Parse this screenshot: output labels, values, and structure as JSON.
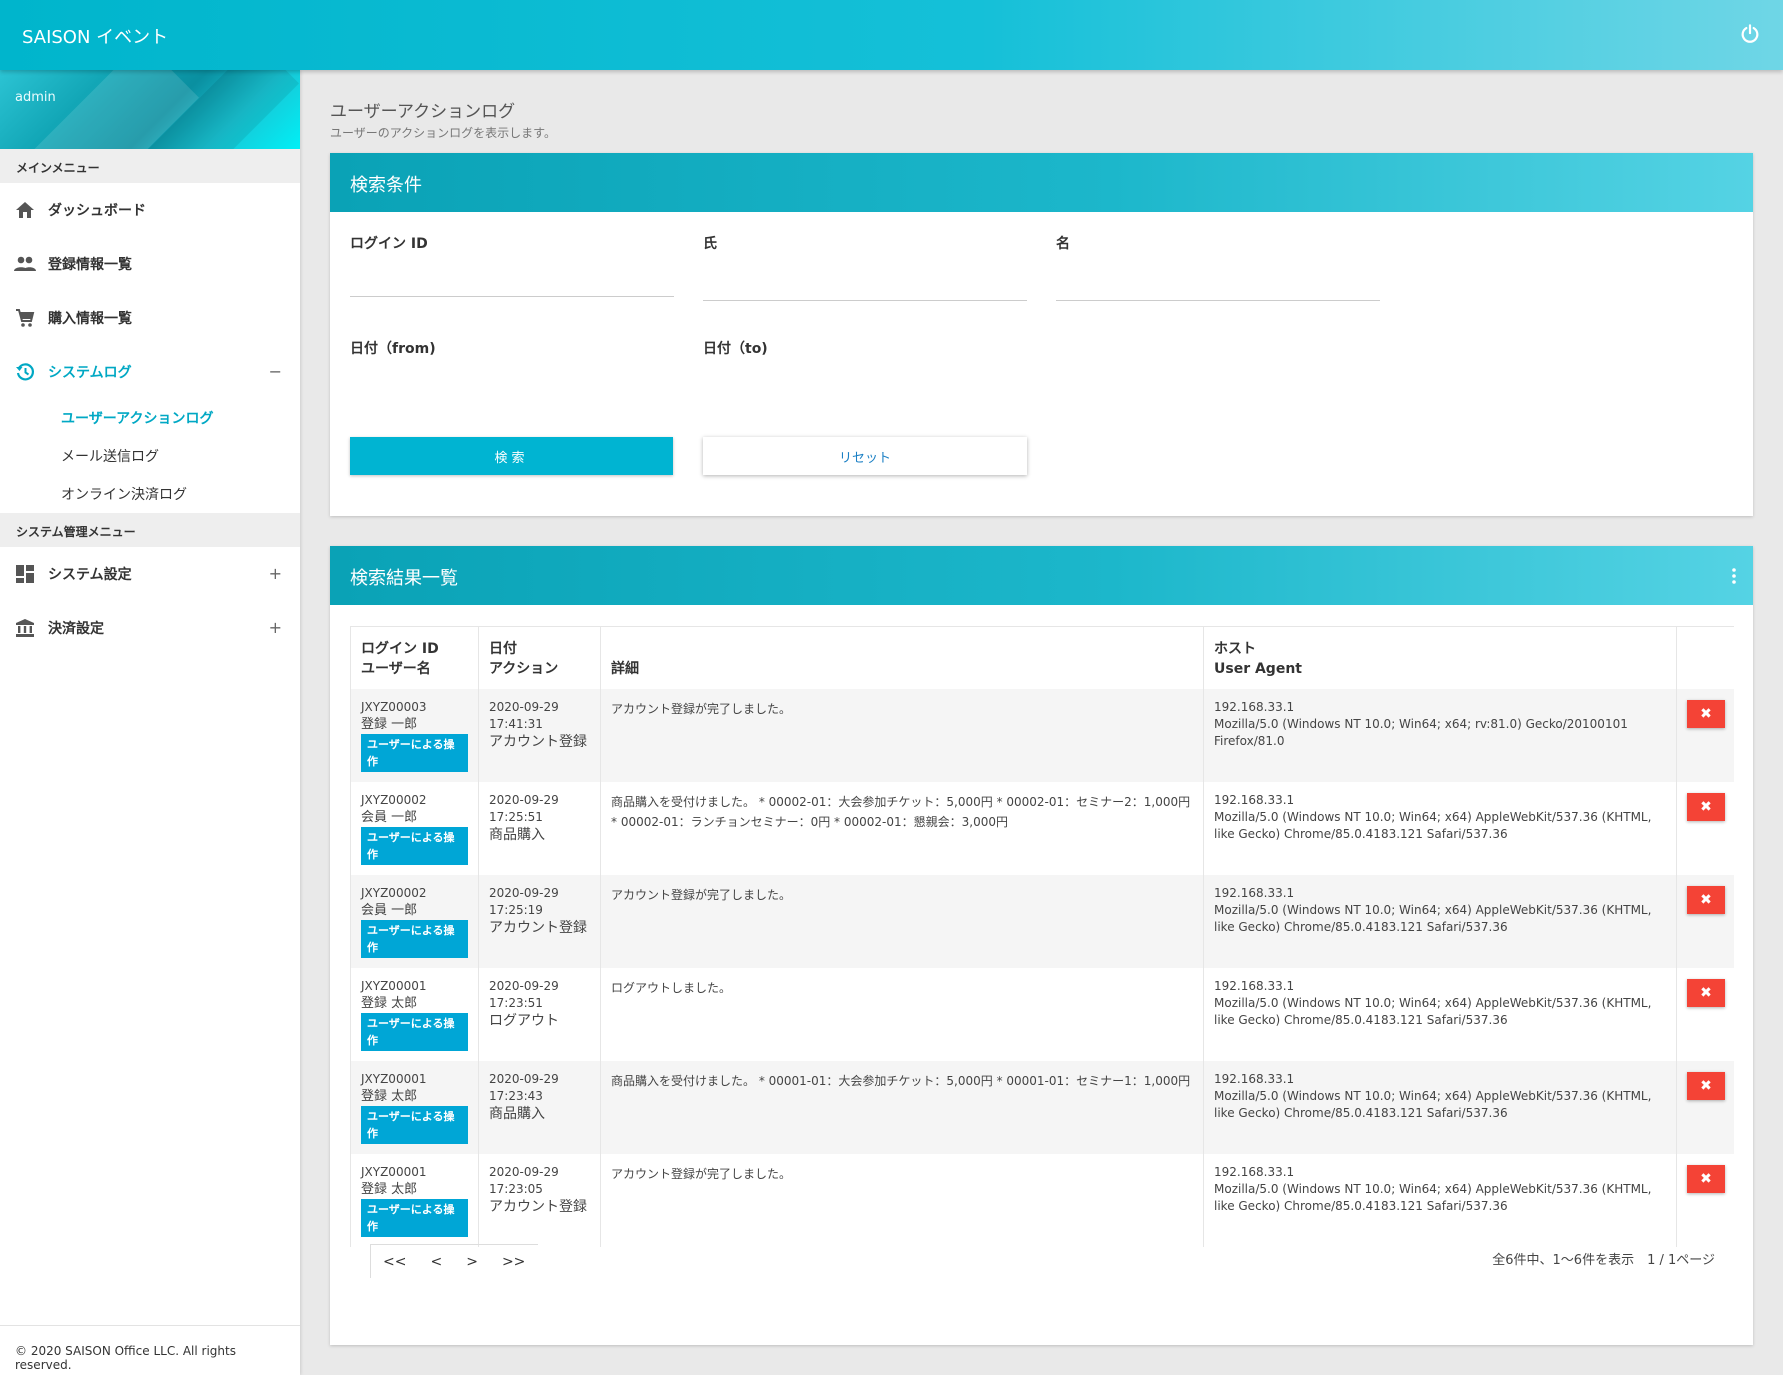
{
  "app": {
    "title": "SAISON イベント"
  },
  "sidebar": {
    "user": "admin",
    "main_menu_header": "メインメニュー",
    "items": [
      {
        "label": "ダッシュボード",
        "icon": "home-icon"
      },
      {
        "label": "登録情報一覧",
        "icon": "people-icon"
      },
      {
        "label": "購入情報一覧",
        "icon": "cart-icon"
      },
      {
        "label": "システムログ",
        "icon": "history-icon",
        "toggle": "−"
      }
    ],
    "subitems": [
      {
        "label": "ユーザーアクションログ"
      },
      {
        "label": "メール送信ログ"
      },
      {
        "label": "オンライン決済ログ"
      }
    ],
    "admin_menu_header": "システム管理メニュー",
    "admin_items": [
      {
        "label": "システム設定",
        "icon": "dashboard-icon",
        "toggle": "+"
      },
      {
        "label": "決済設定",
        "icon": "bank-icon",
        "toggle": "+"
      }
    ],
    "footer": "© 2020 SAISON Office LLC. All rights reserved."
  },
  "page": {
    "title": "ユーザーアクションログ",
    "subtitle": "ユーザーのアクションログを表示します。"
  },
  "search": {
    "header": "検索条件",
    "login_id_label": "ログイン ID",
    "last_name_label": "氏",
    "first_name_label": "名",
    "date_from_label": "日付（from)",
    "date_to_label": "日付（to)",
    "search_button": "検索",
    "reset_button": "リセット"
  },
  "results": {
    "header": "検索結果一覧",
    "columns": {
      "col1_line1": "ログイン ID",
      "col1_line2": "ユーザー名",
      "col2_line1": "日付",
      "col2_line2": "アクション",
      "col3": "詳細",
      "col4_line1": "ホスト",
      "col4_line2": "User Agent"
    },
    "delete_label": "✖",
    "rows": [
      {
        "login_id": "JXYZ00003",
        "name": "登録 一郎",
        "badge": "ユーザーによる操作",
        "date": "2020-09-29",
        "time": "17:41:31",
        "action": "アカウント登録",
        "detail": "アカウント登録が完了しました。",
        "host": "192.168.33.1",
        "ua": "Mozilla/5.0 (Windows NT 10.0; Win64; x64; rv:81.0) Gecko/20100101 Firefox/81.0"
      },
      {
        "login_id": "JXYZ00002",
        "name": "会員 一郎",
        "badge": "ユーザーによる操作",
        "date": "2020-09-29",
        "time": "17:25:51",
        "action": "商品購入",
        "detail": "商品購入を受付けました。 * 00002-01：大会参加チケット：5,000円 * 00002-01：セミナー2：1,000円 * 00002-01：ランチョンセミナー：0円 * 00002-01：懇親会：3,000円",
        "host": "192.168.33.1",
        "ua": "Mozilla/5.0 (Windows NT 10.0; Win64; x64) AppleWebKit/537.36 (KHTML, like Gecko) Chrome/85.0.4183.121 Safari/537.36"
      },
      {
        "login_id": "JXYZ00002",
        "name": "会員 一郎",
        "badge": "ユーザーによる操作",
        "date": "2020-09-29",
        "time": "17:25:19",
        "action": "アカウント登録",
        "detail": "アカウント登録が完了しました。",
        "host": "192.168.33.1",
        "ua": "Mozilla/5.0 (Windows NT 10.0; Win64; x64) AppleWebKit/537.36 (KHTML, like Gecko) Chrome/85.0.4183.121 Safari/537.36"
      },
      {
        "login_id": "JXYZ00001",
        "name": "登録 太郎",
        "badge": "ユーザーによる操作",
        "date": "2020-09-29",
        "time": "17:23:51",
        "action": "ログアウト",
        "detail": "ログアウトしました。",
        "host": "192.168.33.1",
        "ua": "Mozilla/5.0 (Windows NT 10.0; Win64; x64) AppleWebKit/537.36 (KHTML, like Gecko) Chrome/85.0.4183.121 Safari/537.36"
      },
      {
        "login_id": "JXYZ00001",
        "name": "登録 太郎",
        "badge": "ユーザーによる操作",
        "date": "2020-09-29",
        "time": "17:23:43",
        "action": "商品購入",
        "detail": "商品購入を受付けました。 * 00001-01：大会参加チケット：5,000円 * 00001-01：セミナー1：1,000円",
        "host": "192.168.33.1",
        "ua": "Mozilla/5.0 (Windows NT 10.0; Win64; x64) AppleWebKit/537.36 (KHTML, like Gecko) Chrome/85.0.4183.121 Safari/537.36"
      },
      {
        "login_id": "JXYZ00001",
        "name": "登録 太郎",
        "badge": "ユーザーによる操作",
        "date": "2020-09-29",
        "time": "17:23:05",
        "action": "アカウント登録",
        "detail": "アカウント登録が完了しました。",
        "host": "192.168.33.1",
        "ua": "Mozilla/5.0 (Windows NT 10.0; Win64; x64) AppleWebKit/537.36 (KHTML, like Gecko) Chrome/85.0.4183.121 Safari/537.36"
      }
    ],
    "pager": {
      "first": "<<",
      "prev": "<",
      "next": ">",
      "last": ">>"
    },
    "summary": "全6件中、1〜6件を表示　1 / 1ページ"
  },
  "colors": {
    "accent": "#00b4d2",
    "active_menu": "#00a8c4",
    "delete": "#f44336",
    "badge": "#00a6d6"
  }
}
